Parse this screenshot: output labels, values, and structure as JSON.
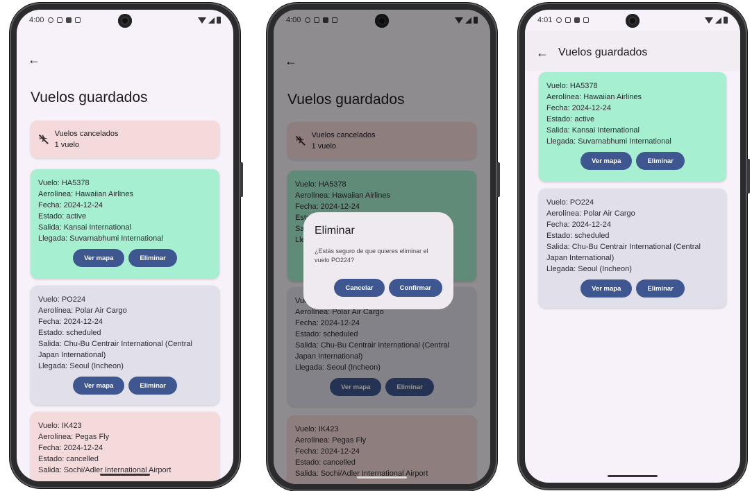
{
  "phones": [
    {
      "time": "4:00",
      "page_title": "Vuelos guardados",
      "cancelled": {
        "title": "Vuelos cancelados",
        "count": "1 vuelo"
      },
      "flights": [
        {
          "vuelo": "Vuelo: HA5378",
          "aerolinea": "Aerolínea: Hawaiian Airlines",
          "fecha": "Fecha: 2024-12-24",
          "estado": "Estado: active",
          "salida": "Salida: Kansai International",
          "llegada": "Llegada: Suvarnabhumi International"
        },
        {
          "vuelo": "Vuelo: PO224",
          "aerolinea": "Aerolínea: Polar Air Cargo",
          "fecha": "Fecha: 2024-12-24",
          "estado": "Estado: scheduled",
          "salida": "Salida: Chu-Bu Centrair International (Central Japan International)",
          "llegada": "Llegada: Seoul (Incheon)"
        },
        {
          "vuelo": "Vuelo: IK423",
          "aerolinea": "Aerolínea: Pegas Fly",
          "fecha": "Fecha: 2024-12-24",
          "estado": "Estado: cancelled",
          "salida": "Salida: Sochi/Adler International Airport"
        }
      ]
    },
    {
      "time": "4:00",
      "page_title": "Vuelos guardados",
      "cancelled": {
        "title": "Vuelos cancelados",
        "count": "1 vuelo"
      },
      "dialog": {
        "title": "Eliminar",
        "message": "¿Estás seguro de que quieres eliminar el vuelo PO224?",
        "cancel": "Cancelar",
        "confirm": "Confirmar"
      }
    },
    {
      "time": "4:01",
      "page_title": "Vuelos guardados"
    }
  ],
  "buttons": {
    "map": "Ver mapa",
    "delete": "Eliminar"
  },
  "colors": {
    "active": "#a7efd1",
    "scheduled": "#e1e0ea",
    "cancelled": "#f4dada",
    "button": "#3f5791"
  }
}
